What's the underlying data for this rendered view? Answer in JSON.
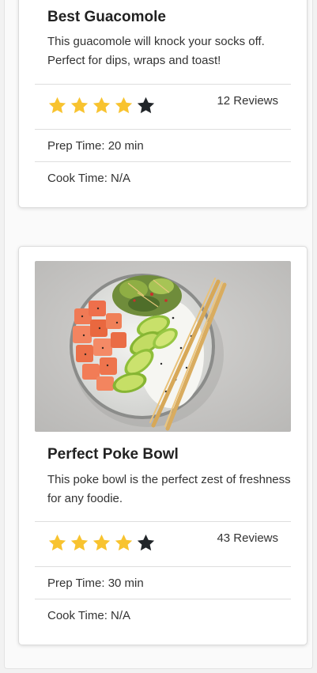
{
  "colors": {
    "star_filled": "#f8c32f",
    "star_empty": "#212529",
    "card_background": "#ffffff",
    "divider": "#dedede"
  },
  "recipes": [
    {
      "title": "Best Guacomole",
      "description": "This guacomole will knock your socks off. Perfect for dips, wraps and toast!",
      "rating": 4,
      "rating_max": 5,
      "reviews_label": "12 Reviews",
      "prep_time": "Prep Time: 20 min",
      "cook_time": "Cook Time: N/A"
    },
    {
      "title": "Perfect Poke Bowl",
      "description": "This poke bowl is the perfect zest of freshness for any foodie.",
      "rating": 4,
      "rating_max": 5,
      "reviews_label": "43 Reviews",
      "prep_time": "Prep Time: 30 min",
      "cook_time": "Cook Time: N/A",
      "image_alt": "Poke bowl with salmon, avocado, rice and chopsticks"
    }
  ]
}
